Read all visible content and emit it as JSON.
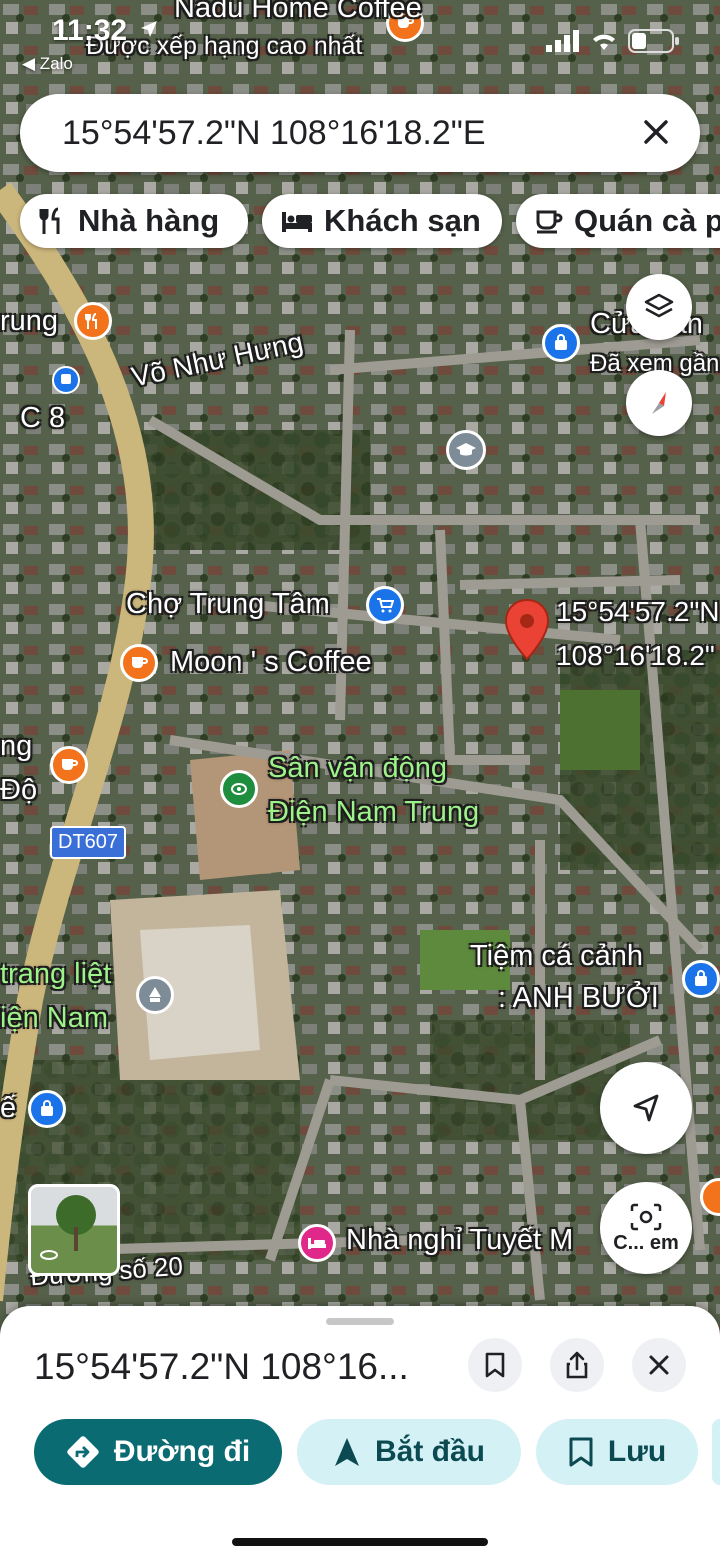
{
  "status_bar": {
    "time": "11:32",
    "back_app": "Zalo"
  },
  "search": {
    "query": "15°54'57.2\"N 108°16'18.2\"E"
  },
  "chips": [
    {
      "label": "Nhà hàng",
      "icon": "restaurant-icon"
    },
    {
      "label": "Khách sạn",
      "icon": "hotel-icon"
    },
    {
      "label": "Quán cà p",
      "icon": "coffee-icon"
    }
  ],
  "map": {
    "poi_top_name": "Nadu Home Coffee",
    "poi_top_sub": "Được xếp hạng cao nhất",
    "labels": {
      "rung": "rung",
      "c8": "C 8",
      "vo_nhu_hung": "Võ Như Hưng",
      "cua_han": "Cửa han",
      "da_xem_gan": "Đã xem gần",
      "cho_trung_tam": "Chợ Trung Tâm",
      "moons_coffee": "Moon ' s Coffee",
      "pin_lat": "15°54'57.2\"N",
      "pin_lng": "108°16'18.2\"",
      "ng": "ng",
      "do": "Độ",
      "dt607": "DT607",
      "san_van_dong_1": "Sân vận động",
      "san_van_dong_2": "Điện Nam Trung",
      "tiem_ca_canh_1": "Tiệm cá cảnh",
      "tiem_ca_canh_2": ": ANH BƯỞI",
      "trang_liet": "trang liệt",
      "dien_nam": "iện Nam",
      "e": "ế",
      "nha_nghi": "Nhà nghỉ Tuyết M",
      "duong_so_20": "Đường số 20",
      "camera_label": "C... em"
    }
  },
  "sheet": {
    "title": "15°54'57.2\"N 108°16...",
    "actions": [
      {
        "label": "Đường đi",
        "icon": "directions-icon"
      },
      {
        "label": "Bắt đầu",
        "icon": "navigation-arrow-icon"
      },
      {
        "label": "Lưu",
        "icon": "bookmark-icon"
      }
    ]
  },
  "colors": {
    "accent": "#0b6b73",
    "action_bg": "#d4f1f6",
    "pin": "#ea4335",
    "poi_orange": "#f2731c",
    "poi_blue": "#1a73e8",
    "poi_green": "#1e8e3e",
    "poi_pink": "#e0278a"
  }
}
